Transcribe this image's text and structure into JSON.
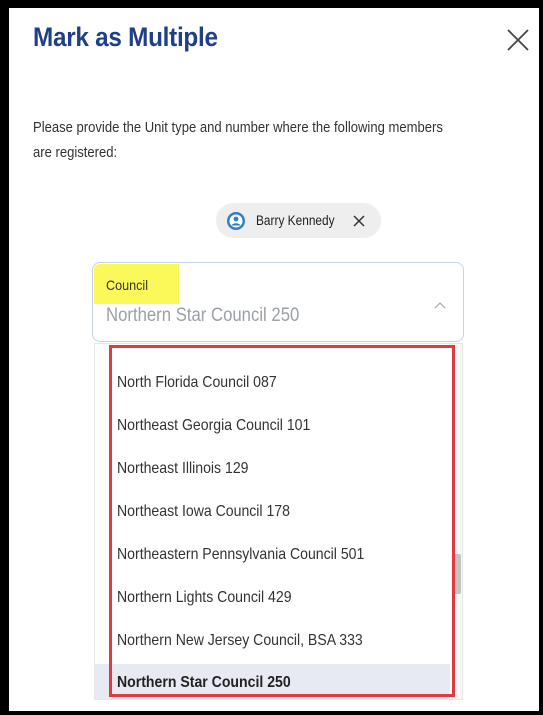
{
  "dialog": {
    "title": "Mark as Multiple",
    "close_label": "X",
    "description": "Please provide the Unit type and number where the following members are registered:"
  },
  "member_chip": {
    "name": "Barry Kennedy",
    "avatar_icon": "user-avatar-icon",
    "remove_icon": "close-icon"
  },
  "council_select": {
    "label": "Council",
    "value": "Northern Star Council 250",
    "caret_icon": "chevron-up-icon",
    "options": [
      "North Florida Council 087",
      "Northeast Georgia Council 101",
      "Northeast Illinois 129",
      "Northeast Iowa Council 178",
      "Northeastern Pennsylvania Council 501",
      "Northern Lights Council 429",
      "Northern New Jersey Council, BSA 333",
      "Northern Star Council 250"
    ],
    "selected_index": 7
  },
  "colors": {
    "title": "#1f3f86",
    "label_highlight": "#fbf85a",
    "annotation_box": "#e0393e",
    "selected_option_bg": "#e7eaf2",
    "avatar": "#2f80c9"
  }
}
